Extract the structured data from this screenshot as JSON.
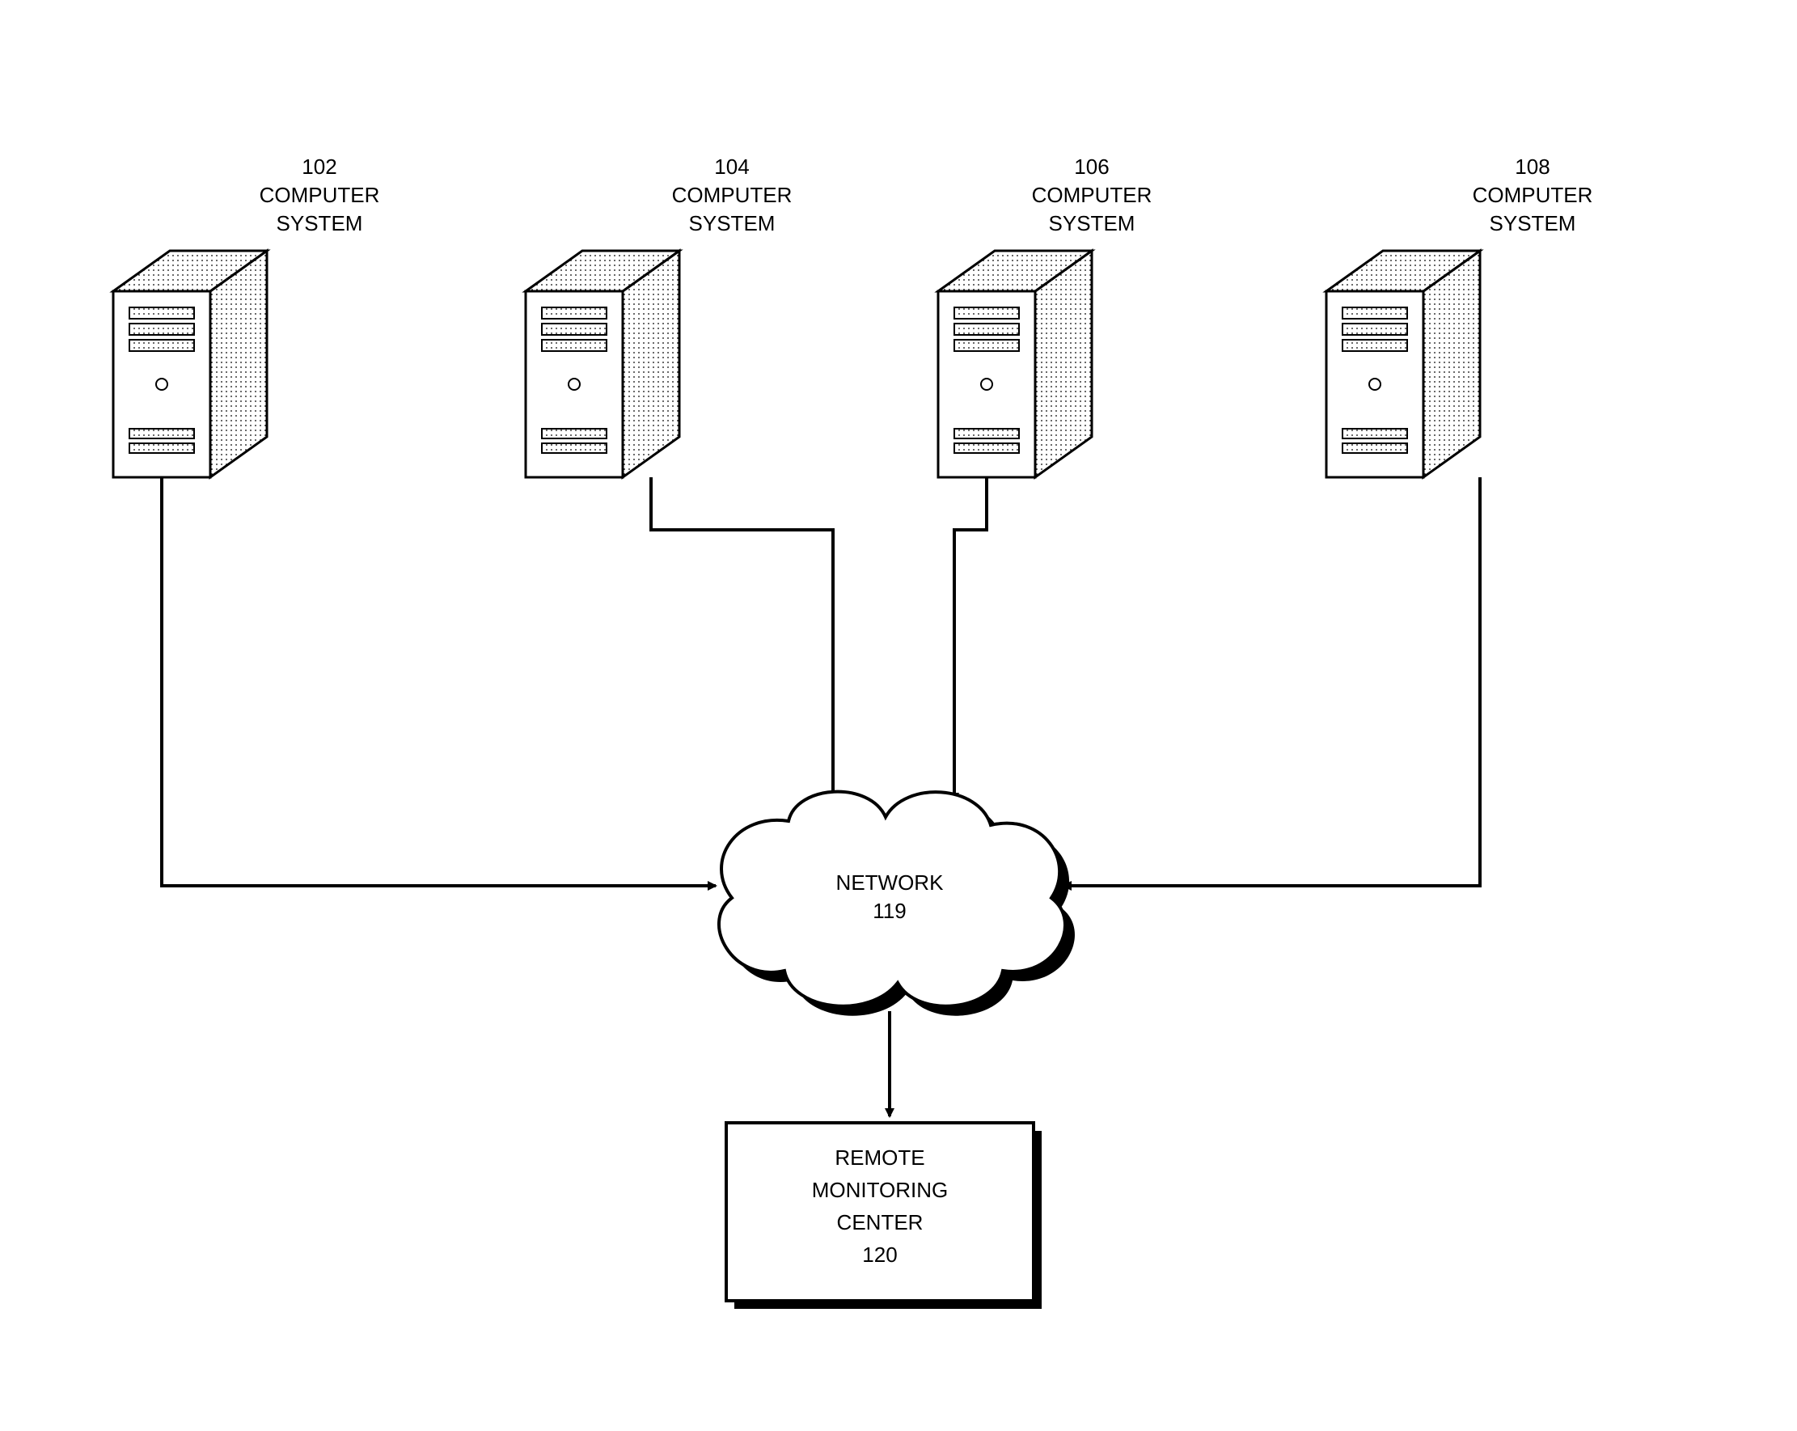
{
  "systems": [
    {
      "id": "102",
      "label_line1": "102",
      "label_line2": "COMPUTER",
      "label_line3": "SYSTEM"
    },
    {
      "id": "104",
      "label_line1": "104",
      "label_line2": "COMPUTER",
      "label_line3": "SYSTEM"
    },
    {
      "id": "106",
      "label_line1": "106",
      "label_line2": "COMPUTER",
      "label_line3": "SYSTEM"
    },
    {
      "id": "108",
      "label_line1": "108",
      "label_line2": "COMPUTER",
      "label_line3": "SYSTEM"
    }
  ],
  "network": {
    "label_line1": "NETWORK",
    "label_line2": "119"
  },
  "monitor": {
    "line1": "REMOTE",
    "line2": "MONITORING",
    "line3": "CENTER",
    "line4": "120"
  }
}
